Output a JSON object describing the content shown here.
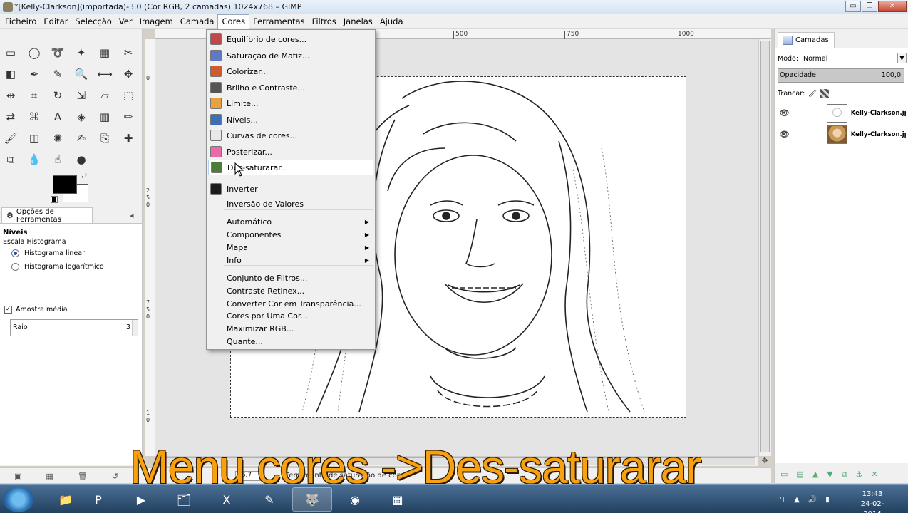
{
  "window": {
    "title": "*[Kelly-Clarkson](importada)-3.0 (Cor RGB, 2 camadas) 1024x768 – GIMP",
    "controls": {
      "minimize": "▭",
      "maximize": "❐",
      "close": "✕"
    }
  },
  "menubar": {
    "items": [
      "Ficheiro",
      "Editar",
      "Selecção",
      "Ver",
      "Imagem",
      "Camada",
      "Cores",
      "Ferramentas",
      "Filtros",
      "Janelas",
      "Ajuda"
    ],
    "active": "Cores"
  },
  "toolbox": {
    "tools": [
      "rect-select-icon",
      "ellipse-select-icon",
      "lasso-select-icon",
      "fuzzy-select-icon",
      "color-select-icon",
      "scissors-select-icon",
      "foreground-select-icon",
      "paths-icon",
      "color-picker-icon",
      "zoom-icon",
      "measure-icon",
      "move-icon",
      "align-icon",
      "crop-icon",
      "rotate-icon",
      "scale-icon",
      "shear-icon",
      "perspective-icon",
      "flip-icon",
      "cage-icon",
      "text-icon",
      "bucket-fill-icon",
      "blend-icon",
      "pencil-icon",
      "paintbrush-icon",
      "eraser-icon",
      "airbrush-icon",
      "ink-icon",
      "clone-icon",
      "heal-icon",
      "perspective-clone-icon",
      "blur-icon",
      "smudge-icon",
      "dodge-burn-icon"
    ],
    "tool_glyphs": [
      "▭",
      "◯",
      "➰",
      "✦",
      "▦",
      "✂",
      "◧",
      "✒",
      "✎",
      "🔍",
      "⟷",
      "✥",
      "⇹",
      "⌗",
      "↻",
      "⇲",
      "▱",
      "⬚",
      "⇄",
      "⌘",
      "A",
      "◈",
      "▥",
      "✏",
      "🖌",
      "◫",
      "✺",
      "✍",
      "⎘",
      "✚",
      "⧉",
      "💧",
      "☝",
      "●"
    ],
    "colors": {
      "foreground": "#000000",
      "background": "#ffffff"
    }
  },
  "tool_options": {
    "tab_label": "Opções de Ferramentas",
    "heading": "Níveis",
    "histogram_scale_label": "Escala Histograma",
    "radio_linear": "Histograma linear",
    "radio_log": "Histograma logarítmico",
    "selected_radio": "linear",
    "sample_average_label": "Amostra média",
    "sample_average_checked": true,
    "radius_label": "Raio",
    "radius_value": "3"
  },
  "canvas": {
    "hruler_ticks": [
      "500",
      "750",
      "1000"
    ],
    "vruler_ticks": [
      "0",
      "2",
      "5",
      "0",
      "7",
      "5",
      "0",
      "1",
      "0"
    ],
    "zoom_value": "66,7",
    "status_message": "Ferramenta de saturação de cores ..."
  },
  "cores_menu": {
    "items": [
      {
        "label": "Equilíbrio de cores...",
        "icon": "color-balance-icon",
        "icon_color": "#c04848"
      },
      {
        "label": "Saturação de Matiz...",
        "icon": "hue-saturation-icon",
        "icon_color": "#5c7ac8"
      },
      {
        "label": "Colorizar...",
        "icon": "colorize-icon",
        "icon_color": "#d05a2a"
      },
      {
        "label": "Brilho e Contraste...",
        "icon": "brightness-contrast-icon",
        "icon_color": "#555555"
      },
      {
        "label": "Limite...",
        "icon": "threshold-icon",
        "icon_color": "#e8a040"
      },
      {
        "label": "Níveis...",
        "icon": "levels-icon",
        "icon_color": "#3b6fb8"
      },
      {
        "label": "Curvas de cores...",
        "icon": "curves-icon",
        "icon_color": "#e8e8e8"
      },
      {
        "label": "Posterizar...",
        "icon": "posterize-icon",
        "icon_color": "#e86aa8"
      },
      {
        "label": "Des-saturarar...",
        "icon": "desaturate-icon",
        "icon_color": "#4c7c3a",
        "highlighted": true
      },
      {
        "label": "Inverter",
        "icon": "invert-icon",
        "icon_color": "#1a1a1a"
      },
      {
        "label": "Inversão de Valores",
        "icon": ""
      },
      {
        "label": "Automático",
        "submenu": true
      },
      {
        "label": "Componentes",
        "submenu": true
      },
      {
        "label": "Mapa",
        "submenu": true
      },
      {
        "label": "Info",
        "submenu": true
      },
      {
        "label": "Conjunto de Filtros..."
      },
      {
        "label": "Contraste Retinex..."
      },
      {
        "label": "Converter Cor em Transparência..."
      },
      {
        "label": "Cores por Uma Cor..."
      },
      {
        "label": "Maximizar RGB..."
      },
      {
        "label": "Quante..."
      }
    ]
  },
  "layers_dock": {
    "tab_label": "Camadas",
    "mode_label": "Modo:",
    "mode_value": "Normal",
    "opacity_label": "Opacidade",
    "opacity_value": "100,0",
    "lock_label": "Trancar:",
    "layers": [
      {
        "name": "Kelly-Clarkson.jp",
        "visible": true,
        "thumb": "sketch"
      },
      {
        "name": "Kelly-Clarkson.jp",
        "visible": true,
        "thumb": "photo"
      }
    ]
  },
  "caption": "Menu cores ->Des-saturarar",
  "taskbar": {
    "apps": [
      "explorer",
      "powerpoint",
      "media-player",
      "file-manager",
      "excel",
      "app",
      "gimp",
      "chrome",
      "video-editor"
    ],
    "language": "PT",
    "time": "13:43",
    "date": "24-02-2014"
  },
  "colors": {
    "caption": "#f7a012",
    "menu_highlight_border": "#b9d3ee"
  }
}
